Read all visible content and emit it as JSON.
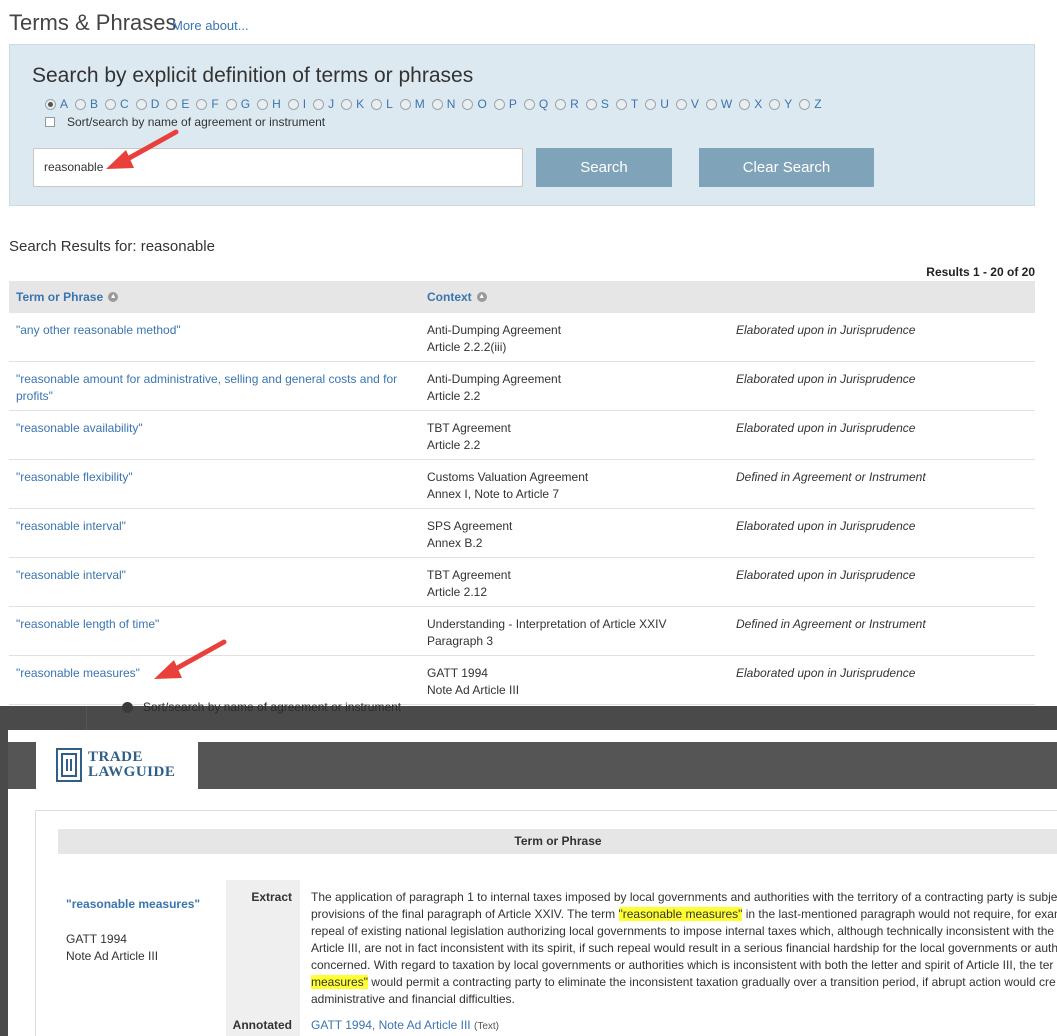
{
  "header": {
    "title": "Terms & Phrases",
    "more_link": "More about..."
  },
  "search": {
    "heading": "Search by explicit definition of terms or phrases",
    "letters": [
      "A",
      "B",
      "C",
      "D",
      "E",
      "F",
      "G",
      "H",
      "I",
      "J",
      "K",
      "L",
      "M",
      "N",
      "O",
      "P",
      "Q",
      "R",
      "S",
      "T",
      "U",
      "V",
      "W",
      "X",
      "Y",
      "Z"
    ],
    "selected_letter": "A",
    "sort_label": "Sort/search by name of agreement or instrument",
    "query": "reasonable",
    "search_button": "Search",
    "clear_button": "Clear Search"
  },
  "results": {
    "title": "Search Results for: reasonable",
    "count": "Results 1 - 20 of 20",
    "col_term": "Term or Phrase",
    "col_context": "Context",
    "rows": [
      {
        "term": "\"any other reasonable method\"",
        "context1": "Anti-Dumping Agreement",
        "context2": "Article 2.2.2(iii)",
        "note": "Elaborated upon in Jurisprudence"
      },
      {
        "term": "\"reasonable amount for administrative, selling and general costs and for profits\"",
        "context1": "Anti-Dumping Agreement",
        "context2": "Article 2.2",
        "note": "Elaborated upon in Jurisprudence"
      },
      {
        "term": "\"reasonable availability\"",
        "context1": "TBT Agreement",
        "context2": "Article 2.2",
        "note": "Elaborated upon in Jurisprudence"
      },
      {
        "term": "\"reasonable flexibility\"",
        "context1": "Customs Valuation Agreement",
        "context2": "Annex I, Note to Article 7",
        "note": "Defined in Agreement or Instrument"
      },
      {
        "term": "\"reasonable interval\"",
        "context1": "SPS Agreement",
        "context2": "Annex B.2",
        "note": "Elaborated upon in Jurisprudence"
      },
      {
        "term": "\"reasonable interval\"",
        "context1": "TBT Agreement",
        "context2": "Article 2.12",
        "note": "Elaborated upon in Jurisprudence"
      },
      {
        "term": "\"reasonable length of time\"",
        "context1": "Understanding - Interpretation of Article XXIV",
        "context2": "Paragraph 3",
        "note": "Defined in Agreement or Instrument"
      },
      {
        "term": "\"reasonable measures\"",
        "context1": "GATT 1994",
        "context2": "Note Ad Article III",
        "note": "Elaborated upon in Jurisprudence"
      }
    ]
  },
  "background_ghost": "Sort/search by name of agreement or instrument",
  "detail": {
    "logo_line1": "TRADE",
    "logo_line2": "LAWGUIDE",
    "table_header": "Term or Phrase",
    "term": "\"reasonable measures\"",
    "context1": "GATT 1994",
    "context2": "Note Ad Article III",
    "extract_label": "Extract",
    "annotated_label": "Annotated",
    "extract_lines": [
      [
        "The application of paragraph 1 to internal taxes imposed by local governments and authorities with the territory of a contracting party is subje"
      ],
      [
        "provisions of the final paragraph of Article XXIV. The term ",
        "\"reasonable measures\"",
        " in the last-mentioned paragraph would not require, for exam"
      ],
      [
        "repeal of existing national legislation authorizing local governments to impose internal taxes which, although technically inconsistent with the"
      ],
      [
        "Article III, are not in fact inconsistent with its spirit, if such repeal would result in a serious financial hardship for the local governments or auth"
      ],
      [
        "concerned. With regard to taxation by local governments or authorities which is inconsistent with both the letter and spirit of Article III, the ter"
      ],
      [
        "",
        "measures\"",
        " would permit a contracting party to eliminate the inconsistent taxation gradually over a transition period, if abrupt action would cre"
      ],
      [
        "administrative and financial difficulties."
      ]
    ],
    "annotated_link": "GATT 1994, Note Ad Article III",
    "annotated_suffix": "(Text)"
  },
  "colors": {
    "link": "#3a75b0",
    "button": "#7fa3b8",
    "panel": "#dde9f1",
    "highlight": "#ffff33",
    "arrow": "#e8403a"
  }
}
